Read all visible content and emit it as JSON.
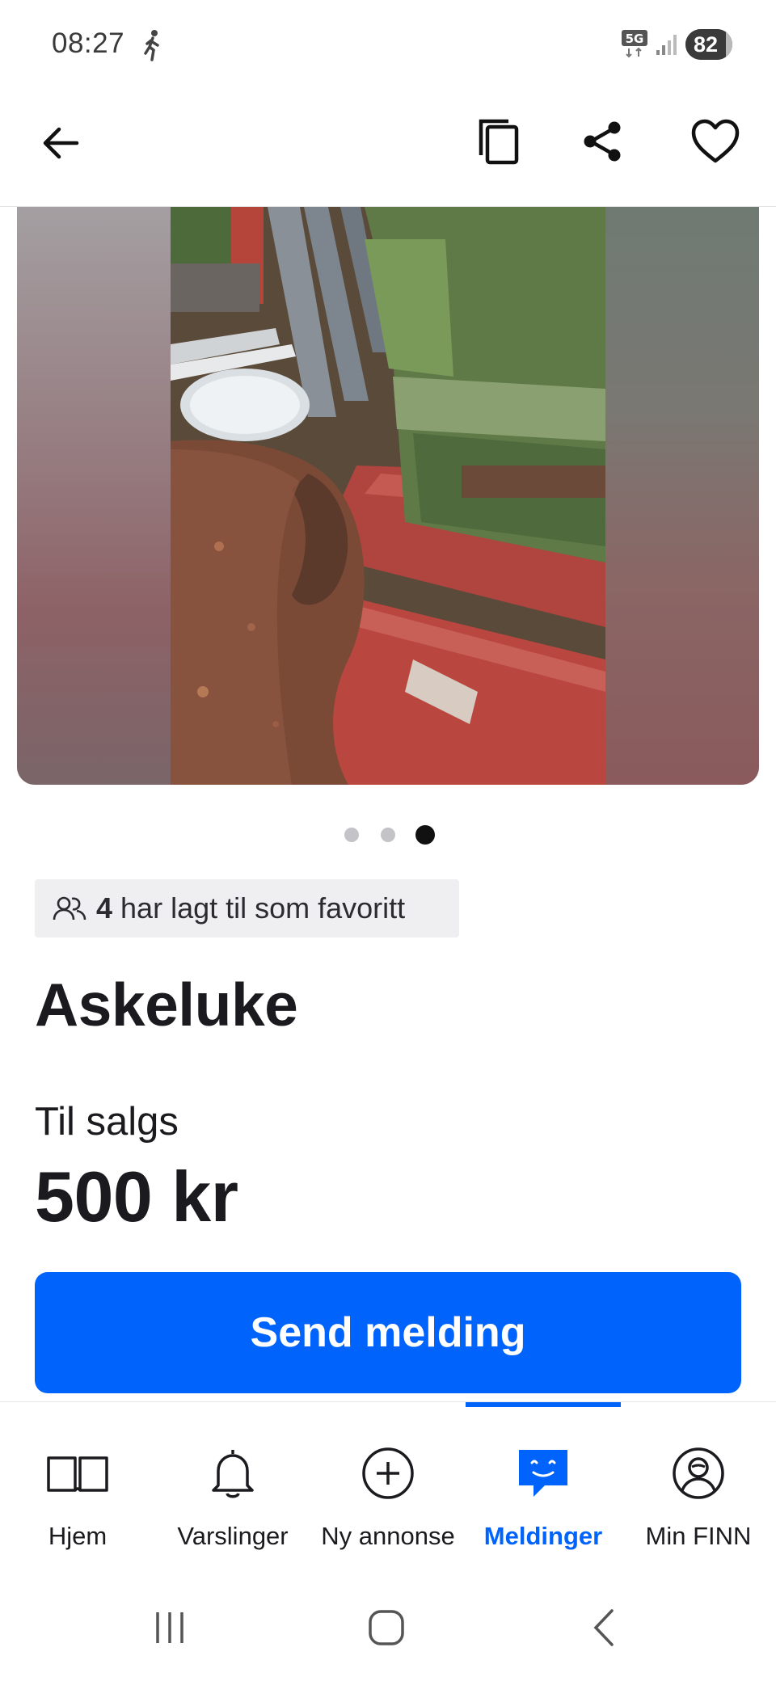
{
  "status_bar": {
    "time": "08:27",
    "network": "5G",
    "battery": "82",
    "battery_level_percent": 82
  },
  "app_bar": {
    "back_icon": "arrow-left-icon",
    "copy_icon": "copy-icon",
    "share_icon": "share-icon",
    "favorite_icon": "heart-outline-icon"
  },
  "carousel": {
    "image_count": 3,
    "active_index": 2
  },
  "favorites": {
    "count": "4",
    "text": "har lagt til som favoritt"
  },
  "listing": {
    "title": "Askeluke",
    "sale_type": "Til salgs",
    "price": "500 kr"
  },
  "actions": {
    "send_message": "Send melding"
  },
  "colors": {
    "accent": "#0063fb",
    "text": "#1b1b1f",
    "badge_bg": "#efeff2"
  },
  "bottom_nav": {
    "items": [
      {
        "label": "Hjem",
        "icon": "book-icon"
      },
      {
        "label": "Varslinger",
        "icon": "bell-icon"
      },
      {
        "label": "Ny annonse",
        "icon": "plus-circle-icon"
      },
      {
        "label": "Meldinger",
        "icon": "chat-bubble-icon",
        "active": true
      },
      {
        "label": "Min FINN",
        "icon": "profile-icon"
      }
    ]
  },
  "system_nav": {
    "recents_icon": "recents-icon",
    "home_icon": "home-icon",
    "back_icon": "back-chevron-icon"
  }
}
